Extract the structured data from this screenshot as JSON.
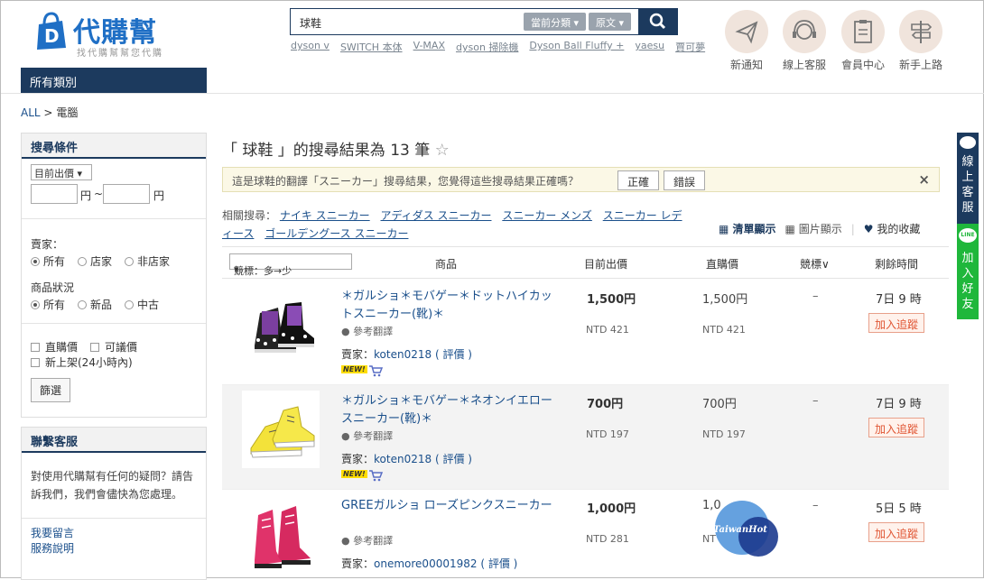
{
  "header": {
    "logo_name": "代購幫",
    "logo_slogan": "找代購幫幫您代購",
    "search_value": "球鞋",
    "search_scope": "當前分類",
    "search_lang": "原文",
    "hot_keywords": [
      "dyson v",
      "SWITCH 本体",
      "V-MAX",
      "dyson 掃除機",
      "Dyson Ball Fluffy +",
      "yaesu",
      "賈可夢"
    ],
    "icons": [
      {
        "label": "新通知",
        "icon": "paper-plane-icon"
      },
      {
        "label": "線上客服",
        "icon": "headset-icon"
      },
      {
        "label": "會員中心",
        "icon": "member-card-icon"
      },
      {
        "label": "新手上路",
        "icon": "signpost-icon"
      }
    ]
  },
  "nav": {
    "all_categories": "所有類別"
  },
  "breadcrumb": {
    "root": "ALL",
    "sep": ">",
    "current": "電腦"
  },
  "filter": {
    "title": "搜尋條件",
    "price_select": "目前出價",
    "yen1": "円",
    "tilde": "~",
    "yen2": "円",
    "seller_label": "賣家：",
    "seller_opts": [
      "所有",
      "店家",
      "非店家"
    ],
    "condition_label": "商品狀況",
    "condition_opts": [
      "所有",
      "新品",
      "中古"
    ],
    "buy_now": "直購價",
    "negotiable": "可議價",
    "new_listing": "新上架(24小時內)",
    "filter_btn": "篩選"
  },
  "contact": {
    "title": "聯繫客服",
    "text": "對使用代購幫有任何的疑問？請告訴我們，我們會儘快為您處理。",
    "link1": "我要留言",
    "link2": "服務說明"
  },
  "results": {
    "title": "「 球鞋 」的搜尋結果為 13 筆",
    "notice": "這是球鞋的翻譯「スニーカー」搜尋結果，您覺得這些搜尋結果正確嗎？",
    "correct": "正確",
    "wrong": "錯誤",
    "close": "×",
    "related_label": "相關搜尋：",
    "related": [
      "ナイキ スニーカー",
      "アディダス スニーカー",
      "スニーカー メンズ",
      "スニーカー レディース",
      "ゴールデングース スニーカー"
    ],
    "view_list": "清單顯示",
    "view_grid": "圖片顯示",
    "favorites": "我的收藏",
    "sort": "競標：多→少",
    "columns": {
      "item": "商品",
      "current": "目前出價",
      "buynow": "直購價",
      "bids": "競標∨",
      "time": "剩餘時間"
    }
  },
  "items": [
    {
      "title": "＊ガルショ＊モバゲー＊ドットハイカットスニーカー(靴)＊",
      "ref": "參考翻譯",
      "seller_label": "賣家：",
      "seller": "koten0218",
      "rate": "( 評價 )",
      "price": "1,500円",
      "ntd": "NTD 421",
      "buynow": "1,500円",
      "buynow_ntd": "NTD 421",
      "bids": "–",
      "time": "7日 9 時",
      "track": "加入追蹤",
      "new": "NEW!"
    },
    {
      "title": "＊ガルショ＊モバゲー＊ネオンイエロースニーカー(靴)＊",
      "ref": "參考翻譯",
      "seller_label": "賣家：",
      "seller": "koten0218",
      "rate": "( 評價 )",
      "price": "700円",
      "ntd": "NTD 197",
      "buynow": "700円",
      "buynow_ntd": "NTD 197",
      "bids": "–",
      "time": "7日 9 時",
      "track": "加入追蹤",
      "new": "NEW!"
    },
    {
      "title": "GREEガルショ ローズピンクスニーカー",
      "ref": "參考翻譯",
      "seller_label": "賣家：",
      "seller": "onemore00001982",
      "rate": "( 評價 )",
      "price": "1,000円",
      "ntd": "NTD 281",
      "buynow": "1,0",
      "buynow_ntd": "NT",
      "bids": "–",
      "time": "5日 5 時",
      "track": "加入追蹤",
      "new": ""
    }
  ],
  "side_tabs": {
    "support": "線上客服",
    "line_badge": "LINE",
    "line": "加入好友"
  },
  "watermark": "TaiwanHot",
  "colors": {
    "navy": "#1c3a5e",
    "link": "#1a4f8b",
    "line_green": "#1fb73b",
    "logo_blue": "#1f6fc5"
  }
}
